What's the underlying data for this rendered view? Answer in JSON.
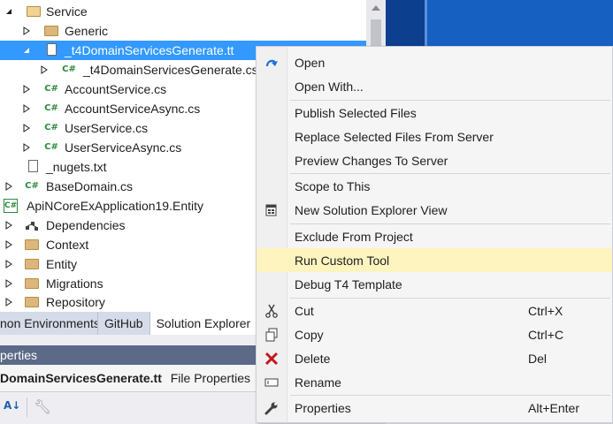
{
  "tree": {
    "items": [
      {
        "label": "Service",
        "icon": "folder-open-icon",
        "expander": "expanded"
      },
      {
        "label": "Generic",
        "icon": "folder-icon",
        "expander": "collapsed"
      },
      {
        "label": "_t4DomainServicesGenerate.tt",
        "icon": "file-icon",
        "expander": "expanded",
        "selected": true
      },
      {
        "label": "_t4DomainServicesGenerate.cs",
        "icon": "csharp-file-icon",
        "expander": "collapsed"
      },
      {
        "label": "AccountService.cs",
        "icon": "csharp-file-icon",
        "expander": "collapsed"
      },
      {
        "label": "AccountServiceAsync.cs",
        "icon": "csharp-file-icon",
        "expander": "collapsed"
      },
      {
        "label": "UserService.cs",
        "icon": "csharp-file-icon",
        "expander": "collapsed"
      },
      {
        "label": "UserServiceAsync.cs",
        "icon": "csharp-file-icon",
        "expander": "collapsed"
      },
      {
        "label": "_nugets.txt",
        "icon": "text-file-icon",
        "expander": "none"
      },
      {
        "label": "BaseDomain.cs",
        "icon": "csharp-file-icon",
        "expander": "collapsed"
      },
      {
        "label": "ApiNCoreExApplication19.Entity",
        "icon": "csharp-project-icon",
        "expander": "none"
      },
      {
        "label": "Dependencies",
        "icon": "dependencies-icon",
        "expander": "collapsed"
      },
      {
        "label": "Context",
        "icon": "folder-icon",
        "expander": "collapsed"
      },
      {
        "label": "Entity",
        "icon": "folder-icon",
        "expander": "collapsed"
      },
      {
        "label": "Migrations",
        "icon": "folder-icon",
        "expander": "collapsed"
      },
      {
        "label": "Repository",
        "icon": "folder-icon",
        "expander": "collapsed"
      }
    ]
  },
  "tabs": [
    {
      "label": "non Environments"
    },
    {
      "label": "GitHub"
    },
    {
      "label": "Solution Explorer",
      "active": true
    }
  ],
  "properties": {
    "header": "perties",
    "object_name": "DomainServicesGenerate.tt",
    "object_type": "File Properties"
  },
  "menu": {
    "items": [
      {
        "label": "Open",
        "icon": "open-arrow-icon",
        "shortcut": ""
      },
      {
        "label": "Open With...",
        "icon": "",
        "shortcut": ""
      },
      {
        "label": "Publish Selected Files",
        "icon": "",
        "shortcut": ""
      },
      {
        "label": "Replace Selected Files From Server",
        "icon": "",
        "shortcut": ""
      },
      {
        "label": "Preview Changes To Server",
        "icon": "",
        "shortcut": ""
      },
      {
        "label": "Scope to This",
        "icon": "",
        "shortcut": ""
      },
      {
        "label": "New Solution Explorer View",
        "icon": "new-view-icon",
        "shortcut": ""
      },
      {
        "label": "Exclude From Project",
        "icon": "",
        "shortcut": ""
      },
      {
        "label": "Run Custom Tool",
        "icon": "",
        "shortcut": "",
        "highlighted": true
      },
      {
        "label": "Debug T4 Template",
        "icon": "",
        "shortcut": ""
      },
      {
        "label": "Cut",
        "icon": "scissors-icon",
        "shortcut": "Ctrl+X"
      },
      {
        "label": "Copy",
        "icon": "copy-icon",
        "shortcut": "Ctrl+C"
      },
      {
        "label": "Delete",
        "icon": "delete-x-icon",
        "shortcut": "Del"
      },
      {
        "label": "Rename",
        "icon": "rename-icon",
        "shortcut": ""
      },
      {
        "label": "Properties",
        "icon": "wrench-icon",
        "shortcut": "Alt+Enter"
      }
    ]
  },
  "colors": {
    "selection": "#3399ff",
    "menu_highlight": "#fdf4bf",
    "desktop": "#1560c0",
    "delete_red": "#c4161c"
  }
}
